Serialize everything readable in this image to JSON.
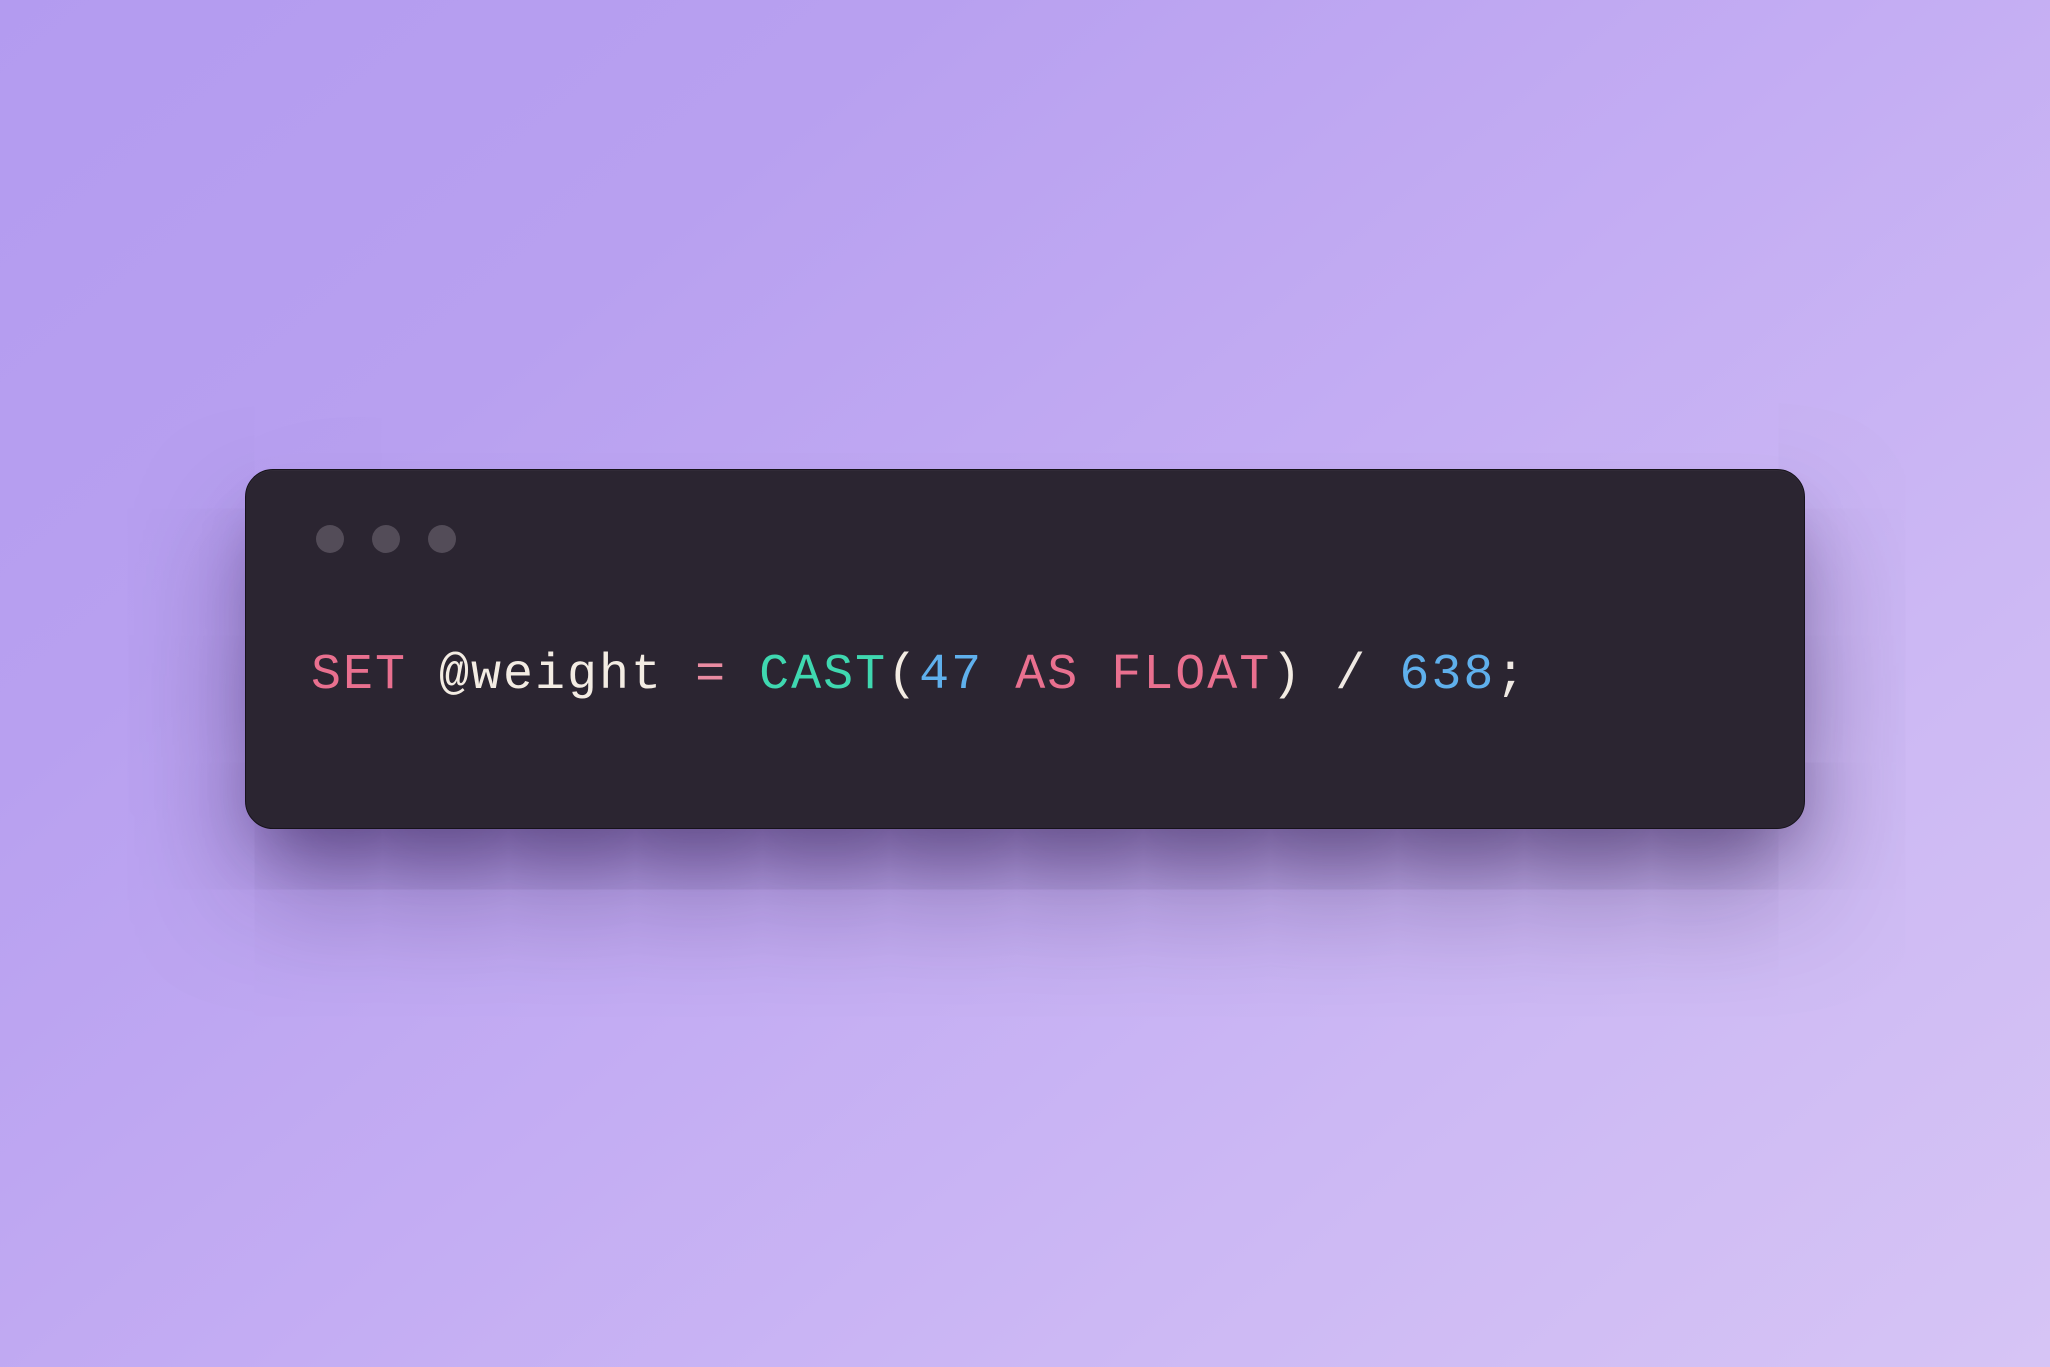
{
  "code": {
    "tokens": {
      "set": "SET",
      "space1": " ",
      "variable": "@weight",
      "space2": " ",
      "equals": "=",
      "space3": " ",
      "cast": "CAST",
      "lparen": "(",
      "num1": "47",
      "space4": " ",
      "as": "AS",
      "space5": " ",
      "float": "FLOAT",
      "rparen": ")",
      "space6": " ",
      "slash": "/",
      "space7": " ",
      "num2": "638",
      "semicolon": ";"
    }
  }
}
